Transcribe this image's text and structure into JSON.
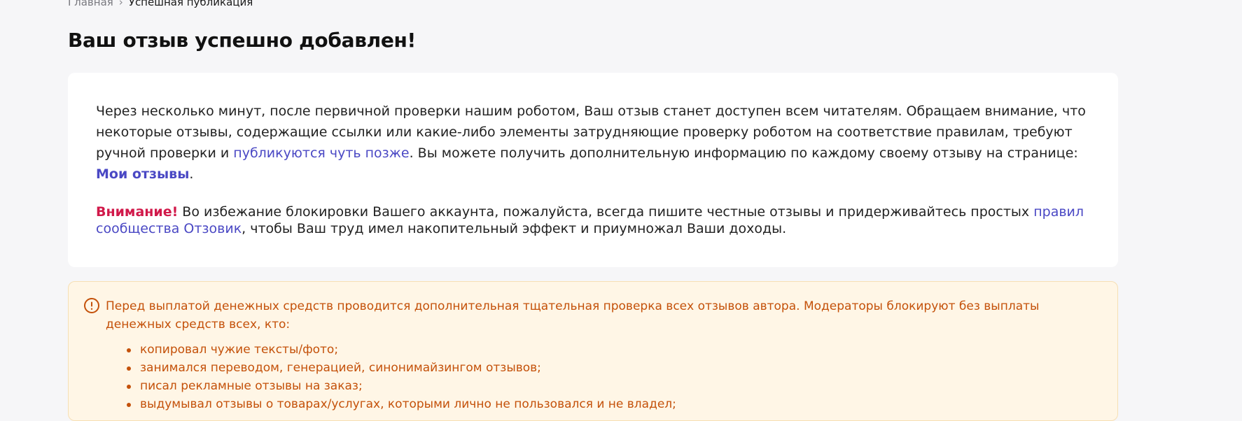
{
  "breadcrumb": {
    "home": "Главная",
    "separator": "›",
    "current": "Успешная публикация"
  },
  "page_title": "Ваш отзыв успешно добавлен!",
  "success_card": {
    "p1_before_link": "Через несколько минут, после первичной проверки нашим роботом, Ваш отзыв станет доступен всем читателям. Обращаем внимание, что некоторые отзывы, содержащие ссылки или какие-либо элементы затрудняющие проверку роботом на соответствие правилам, требуют ручной проверки и ",
    "p1_link_later": "публикуются чуть позже",
    "p1_after_link": ". Вы можете получить дополнительную информацию по каждому своему отзыву на странице: ",
    "p1_link_my_reviews": "Мои отзывы",
    "p1_end": ".",
    "warning_label": "Внимание!",
    "warning_text": " Во избежание блокировки Вашего аккаунта, пожалуйста, всегда пишите честные отзывы и придерживайтесь простых ",
    "warning_link": "правил сообщества Отзовик",
    "warning_end": ", чтобы Ваш труд имел накопительный эффект и приумножал Ваши доходы."
  },
  "notice": {
    "icon": "exclamation-circle-icon",
    "intro": "Перед выплатой денежных средств проводится дополнительная тщательная проверка всех отзывов автора. Модераторы блокируют без выплаты денежных средств всех, кто:",
    "items": [
      "копировал чужие тексты/фото;",
      "занимался переводом, генерацией, синонимайзингом отзывов;",
      "писал рекламные отзывы на заказ;",
      "выдумывал отзывы о товарах/услугах, которыми лично не пользовался и не владел;"
    ]
  },
  "colors": {
    "page_bg": "#f6f6f8",
    "link": "#4a48c4",
    "warning_label": "#d1194a",
    "notice_text": "#c4510a",
    "notice_bg": "#fff6e6"
  }
}
